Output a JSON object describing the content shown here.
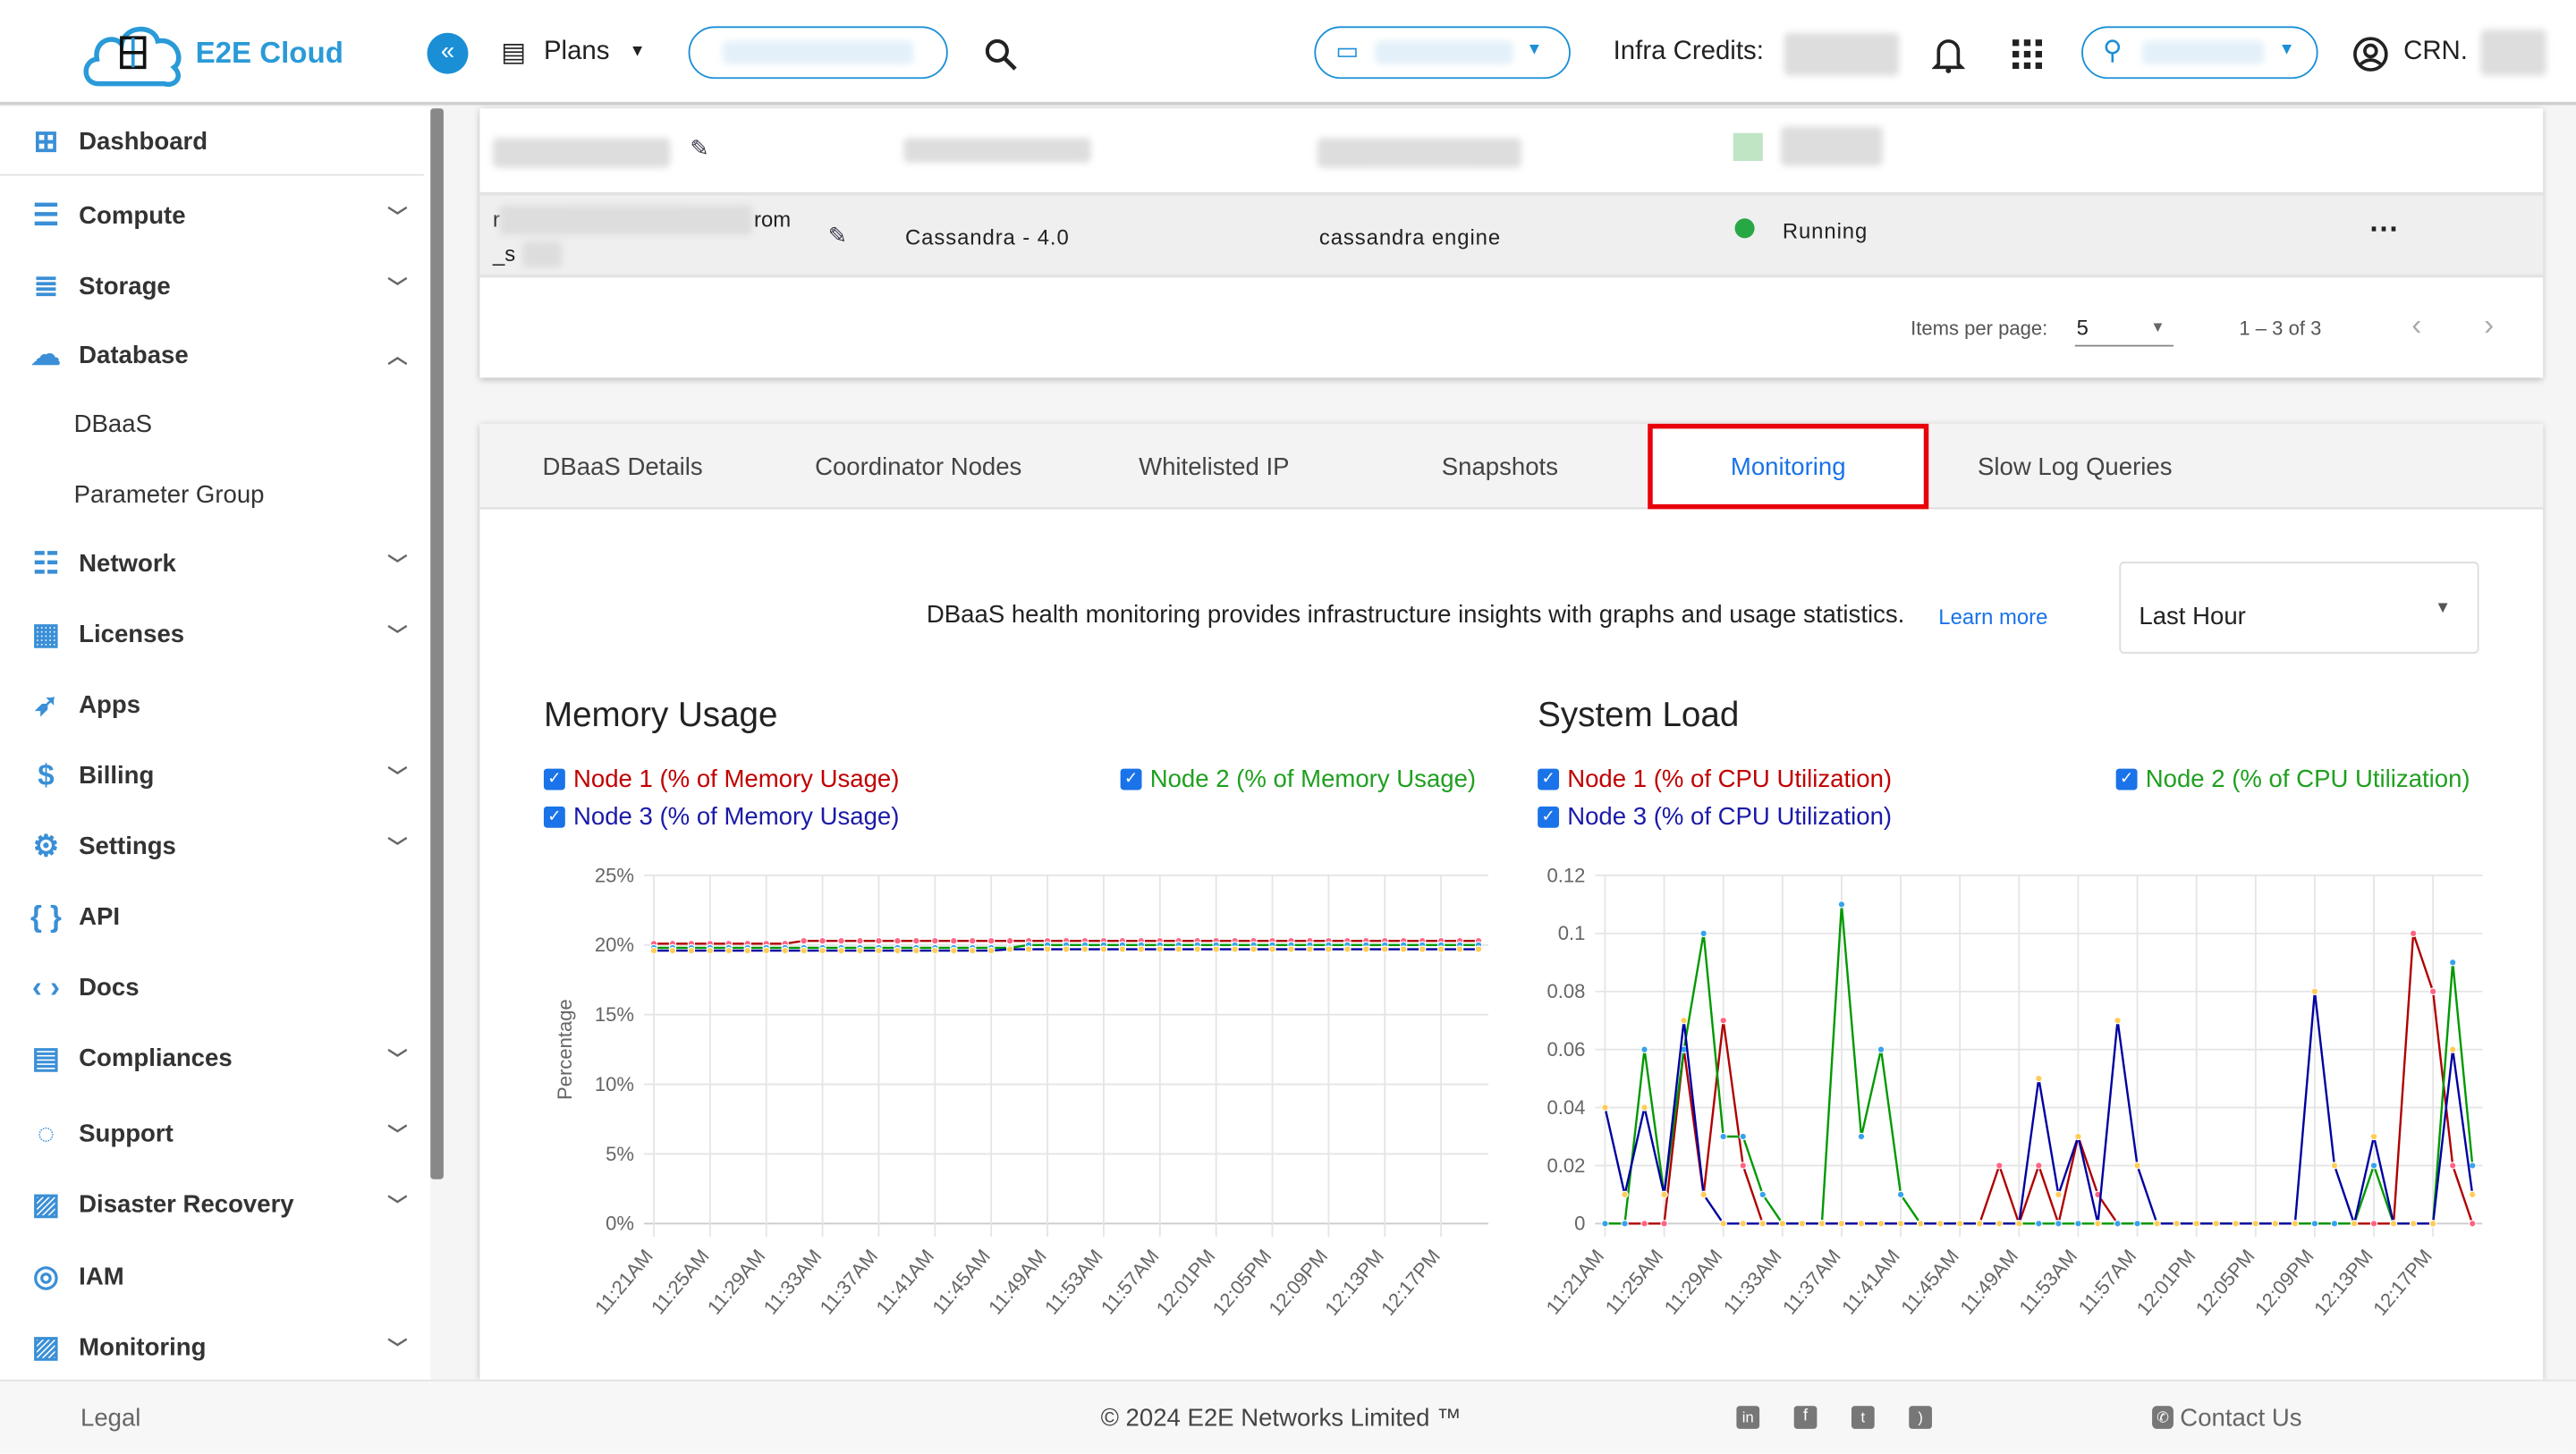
{
  "header": {
    "brand": "E2E Cloud",
    "logo_text": "E2E Cloud",
    "plans_label": "Plans",
    "credits_label": "Infra Credits:",
    "crn_label": "CRN."
  },
  "sidebar": {
    "items": [
      {
        "label": "Dashboard",
        "icon": "dashboard-icon",
        "chevron": ""
      },
      {
        "label": "Compute",
        "icon": "server-icon",
        "chevron": "down"
      },
      {
        "label": "Storage",
        "icon": "database-stack-icon",
        "chevron": "down"
      },
      {
        "label": "Database",
        "icon": "cloud-network-icon",
        "chevron": "up"
      },
      {
        "label": "Network",
        "icon": "network-icon",
        "chevron": "down"
      },
      {
        "label": "Licenses",
        "icon": "license-icon",
        "chevron": "down"
      },
      {
        "label": "Apps",
        "icon": "rocket-icon",
        "chevron": ""
      },
      {
        "label": "Billing",
        "icon": "billing-icon",
        "chevron": "down"
      },
      {
        "label": "Settings",
        "icon": "gear-icon",
        "chevron": "down"
      },
      {
        "label": "API",
        "icon": "braces-icon",
        "chevron": ""
      },
      {
        "label": "Docs",
        "icon": "code-icon",
        "chevron": ""
      },
      {
        "label": "Compliances",
        "icon": "document-icon",
        "chevron": "down"
      },
      {
        "label": "Support",
        "icon": "support-icon",
        "chevron": "down"
      },
      {
        "label": "Disaster Recovery",
        "icon": "image-icon",
        "chevron": "down"
      },
      {
        "label": "IAM",
        "icon": "iam-icon",
        "chevron": ""
      },
      {
        "label": "Monitoring",
        "icon": "image-icon",
        "chevron": "down"
      }
    ],
    "database_sub": [
      "DBaaS",
      "Parameter Group"
    ]
  },
  "table": {
    "row2": {
      "name_start": "r",
      "name_end": "rom",
      "name_line2": "_s",
      "version": "Cassandra - 4.0",
      "engine": "cassandra engine",
      "status": "Running"
    },
    "items_per_page_label": "Items per page:",
    "items_per_page": "5",
    "range": "1 – 3 of 3"
  },
  "tabs": [
    {
      "label": "DBaaS Details"
    },
    {
      "label": "Coordinator Nodes"
    },
    {
      "label": "Whitelisted IP"
    },
    {
      "label": "Snapshots"
    },
    {
      "label": "Monitoring",
      "active": true
    },
    {
      "label": "Slow Log Queries"
    }
  ],
  "monitoring": {
    "description": "DBaaS health monitoring provides infrastructure insights with graphs and usage statistics.",
    "learn_more": "Learn more",
    "range_select": "Last Hour"
  },
  "colors": {
    "accent": "#1a73e8",
    "brand": "#1b8fd6",
    "active_tab_border": "#e8000b",
    "running": "#28a745"
  },
  "chart_data": [
    {
      "type": "line",
      "title": "Memory Usage",
      "ylabel": "Percentage",
      "ylim": [
        0,
        25
      ],
      "yticks": [
        "0%",
        "5%",
        "10%",
        "15%",
        "20%",
        "25%"
      ],
      "grid": true,
      "x_tick_labels": [
        "11:21AM",
        "11:25AM",
        "11:29AM",
        "11:33AM",
        "11:37AM",
        "11:41AM",
        "11:45AM",
        "11:49AM",
        "11:53AM",
        "11:57AM",
        "12:01PM",
        "12:05PM",
        "12:09PM",
        "12:13PM",
        "12:17PM"
      ],
      "series": [
        {
          "name": "Node 1 (% of Memory Usage)",
          "color": "#b00000",
          "marker": "#ff6384",
          "values": [
            20.1,
            20.1,
            20.1,
            20.1,
            20.1,
            20.1,
            20.1,
            20.1,
            20.3,
            20.3,
            20.3,
            20.3,
            20.3,
            20.3,
            20.3,
            20.3,
            20.3,
            20.3,
            20.3,
            20.3,
            20.3,
            20.3,
            20.3,
            20.3,
            20.3,
            20.3,
            20.3,
            20.3,
            20.3,
            20.3,
            20.3,
            20.3,
            20.3,
            20.3,
            20.3,
            20.3,
            20.3,
            20.3,
            20.3,
            20.3,
            20.3,
            20.3,
            20.3,
            20.3,
            20.3
          ]
        },
        {
          "name": "Node 2 (% of Memory Usage)",
          "color": "#009900",
          "marker": "#36a2eb",
          "values": [
            19.8,
            19.8,
            19.8,
            19.8,
            19.8,
            19.8,
            19.8,
            19.8,
            19.8,
            19.8,
            19.8,
            19.8,
            19.8,
            19.8,
            19.8,
            19.8,
            19.8,
            19.8,
            19.8,
            19.8,
            20.0,
            20.0,
            20.0,
            20.0,
            20.0,
            20.0,
            20.0,
            20.0,
            20.0,
            20.0,
            20.0,
            20.0,
            20.0,
            20.0,
            20.0,
            20.0,
            20.0,
            20.0,
            20.0,
            20.0,
            20.0,
            20.0,
            20.0,
            20.0,
            20.0
          ]
        },
        {
          "name": "Node 3 (% of Memory Usage)",
          "color": "#0000a0",
          "marker": "#ffcd56",
          "values": [
            19.6,
            19.6,
            19.6,
            19.6,
            19.6,
            19.6,
            19.6,
            19.6,
            19.6,
            19.6,
            19.6,
            19.6,
            19.6,
            19.6,
            19.6,
            19.6,
            19.6,
            19.6,
            19.6,
            19.7,
            19.7,
            19.7,
            19.7,
            19.7,
            19.7,
            19.7,
            19.7,
            19.7,
            19.7,
            19.7,
            19.7,
            19.7,
            19.7,
            19.7,
            19.7,
            19.7,
            19.7,
            19.7,
            19.7,
            19.7,
            19.7,
            19.7,
            19.7,
            19.7,
            19.7
          ]
        }
      ]
    },
    {
      "type": "line",
      "title": "System Load",
      "ylabel": "",
      "ylim": [
        0,
        0.12
      ],
      "yticks": [
        "0",
        "0.02",
        "0.04",
        "0.06",
        "0.08",
        "0.1",
        "0.12"
      ],
      "grid": true,
      "x_tick_labels": [
        "11:21AM",
        "11:25AM",
        "11:29AM",
        "11:33AM",
        "11:37AM",
        "11:41AM",
        "11:45AM",
        "11:49AM",
        "11:53AM",
        "11:57AM",
        "12:01PM",
        "12:05PM",
        "12:09PM",
        "12:13PM",
        "12:17PM"
      ],
      "series": [
        {
          "name": "Node 1 (% of CPU Utilization)",
          "color": "#b00000",
          "marker": "#ff6384",
          "values": [
            0,
            0,
            0,
            0,
            0.06,
            0.01,
            0.07,
            0.02,
            0,
            0,
            0,
            0,
            0,
            0,
            0,
            0,
            0,
            0,
            0,
            0,
            0.02,
            0,
            0.02,
            0,
            0.03,
            0.01,
            0,
            0,
            0,
            0,
            0,
            0,
            0,
            0,
            0,
            0,
            0,
            0,
            0,
            0,
            0,
            0.1,
            0.08,
            0.02,
            0
          ]
        },
        {
          "name": "Node 2 (% of CPU Utilization)",
          "color": "#009900",
          "marker": "#36a2eb",
          "values": [
            0,
            0,
            0.06,
            0.01,
            0.06,
            0.1,
            0.03,
            0.03,
            0.01,
            0,
            0,
            0,
            0.11,
            0.03,
            0.06,
            0.01,
            0,
            0,
            0,
            0,
            0,
            0,
            0,
            0,
            0,
            0,
            0,
            0,
            0,
            0,
            0,
            0,
            0,
            0,
            0,
            0,
            0,
            0,
            0,
            0.02,
            0,
            0,
            0,
            0.09,
            0.02
          ]
        },
        {
          "name": "Node 3 (% of CPU Utilization)",
          "color": "#0000a0",
          "marker": "#ffcd56",
          "values": [
            0.04,
            0.01,
            0.04,
            0.01,
            0.07,
            0.01,
            0,
            0,
            0,
            0,
            0,
            0,
            0,
            0,
            0,
            0,
            0,
            0,
            0,
            0,
            0,
            0,
            0.05,
            0.01,
            0.03,
            0,
            0.07,
            0.02,
            0,
            0,
            0,
            0,
            0,
            0,
            0,
            0,
            0.08,
            0.02,
            0,
            0.03,
            0,
            0,
            0,
            0.06,
            0.01
          ]
        }
      ]
    }
  ],
  "footer": {
    "legal": "Legal",
    "copyright": "© 2024 E2E Networks Limited ™",
    "contact": "Contact Us"
  }
}
